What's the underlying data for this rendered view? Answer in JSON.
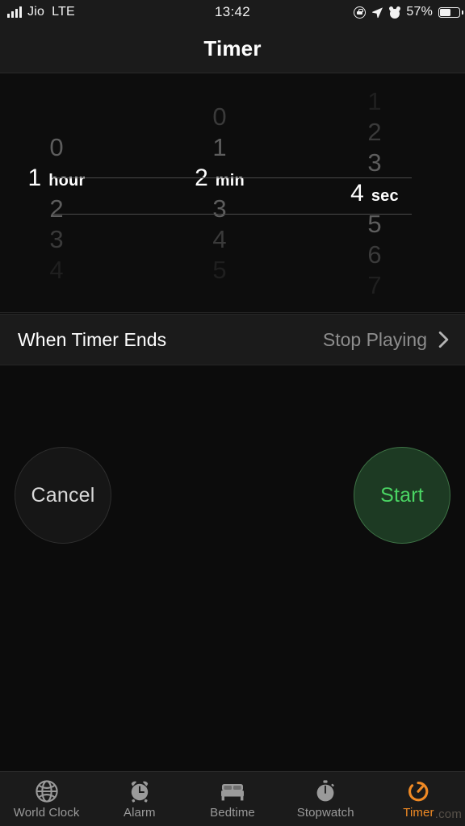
{
  "status_bar": {
    "carrier": "Jio",
    "network": "LTE",
    "time": "13:42",
    "battery_percent": "57%",
    "icons": [
      "signal-bars-icon",
      "rotation-lock-icon",
      "location-arrow-icon",
      "alarm-icon",
      "battery-icon"
    ]
  },
  "nav": {
    "title": "Timer"
  },
  "picker": {
    "columns": [
      {
        "name": "hours",
        "unit": "hour",
        "selected": "1",
        "above": [
          "",
          "0"
        ],
        "below": [
          "2",
          "3",
          "4"
        ]
      },
      {
        "name": "minutes",
        "unit": "min",
        "selected": "2",
        "above": [
          "0",
          "1"
        ],
        "below": [
          "3",
          "4",
          "5"
        ]
      },
      {
        "name": "seconds",
        "unit": "sec",
        "selected": "4",
        "above": [
          "1",
          "2",
          "3"
        ],
        "below": [
          "5",
          "6",
          "7"
        ]
      }
    ]
  },
  "when_timer_ends": {
    "label": "When Timer Ends",
    "value": "Stop Playing",
    "chevron": "chevron-right-icon"
  },
  "actions": {
    "cancel_label": "Cancel",
    "start_label": "Start"
  },
  "tabbar": {
    "items": [
      {
        "label": "World Clock",
        "icon": "globe-icon",
        "active": false
      },
      {
        "label": "Alarm",
        "icon": "alarm-clock-icon",
        "active": false
      },
      {
        "label": "Bedtime",
        "icon": "bed-icon",
        "active": false
      },
      {
        "label": "Stopwatch",
        "icon": "stopwatch-icon",
        "active": false
      },
      {
        "label": "Timer",
        "icon": "timer-icon",
        "active": true
      }
    ]
  },
  "watermark": ".com",
  "colors": {
    "accent_orange": "#f08a24",
    "start_green": "#4ad463",
    "background": "#0c0c0c",
    "panel": "#1b1b1b"
  }
}
